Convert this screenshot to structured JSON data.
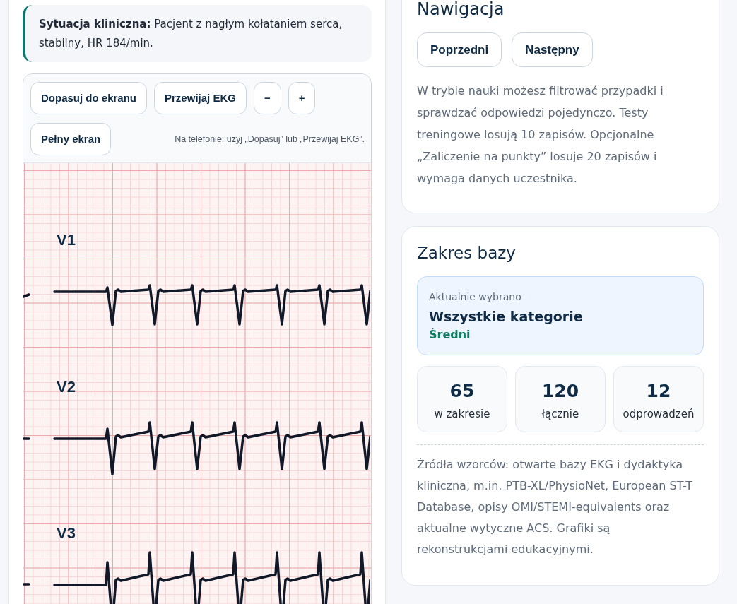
{
  "clinical_situation": {
    "text": "**Sytuacja kliniczna:** Pacjent z nagłym kołataniem serca, stabilny, HR 184/min."
  },
  "ecg_viewer": {
    "toolbar": {
      "buttons": [
        "Dopasuj do ekranu",
        "Przewijaj EKG",
        "−",
        "+",
        "Pełny ekran"
      ],
      "hint": "Na telefonie: użyj „Dopasuj” lub „Przewijaj EKG”."
    },
    "leads": [
      {
        "label": "V1"
      },
      {
        "label": "V2"
      },
      {
        "label": "V3"
      }
    ]
  },
  "navigation": {
    "title": "Nawigacja",
    "buttons": [
      "Poprzedni",
      "Następny"
    ],
    "description": "W trybie nauki możesz filtrować przypadki i sprawdzać odpowiedzi pojedynczo. Testy treningowe losują 10 zapisów. Opcjonalne „Zaliczenie na punkty” losuje 20 zapisów i wymaga danych uczestnika."
  },
  "database_scope": {
    "title": "Zakres bazy",
    "selection": {
      "caption": "Aktualnie wybrano",
      "category": "Wszystkie kategorie",
      "difficulty": "Średni"
    },
    "stats": [
      {
        "value": "65",
        "label": "w zakresie"
      },
      {
        "value": "120",
        "label": "łącznie"
      },
      {
        "value": "12",
        "label": "odprowadzeń"
      }
    ],
    "sources": "Źródła wzorców: otwarte bazy EKG i dydaktyka kliniczna, m.in. PTB-XL/PhysioNet, European ST-T Database, opisy OMI/STEMI-equivalents oraz aktualne wytyczne ACS. Grafiki są rekonstrukcjami edukacyjnymi."
  }
}
